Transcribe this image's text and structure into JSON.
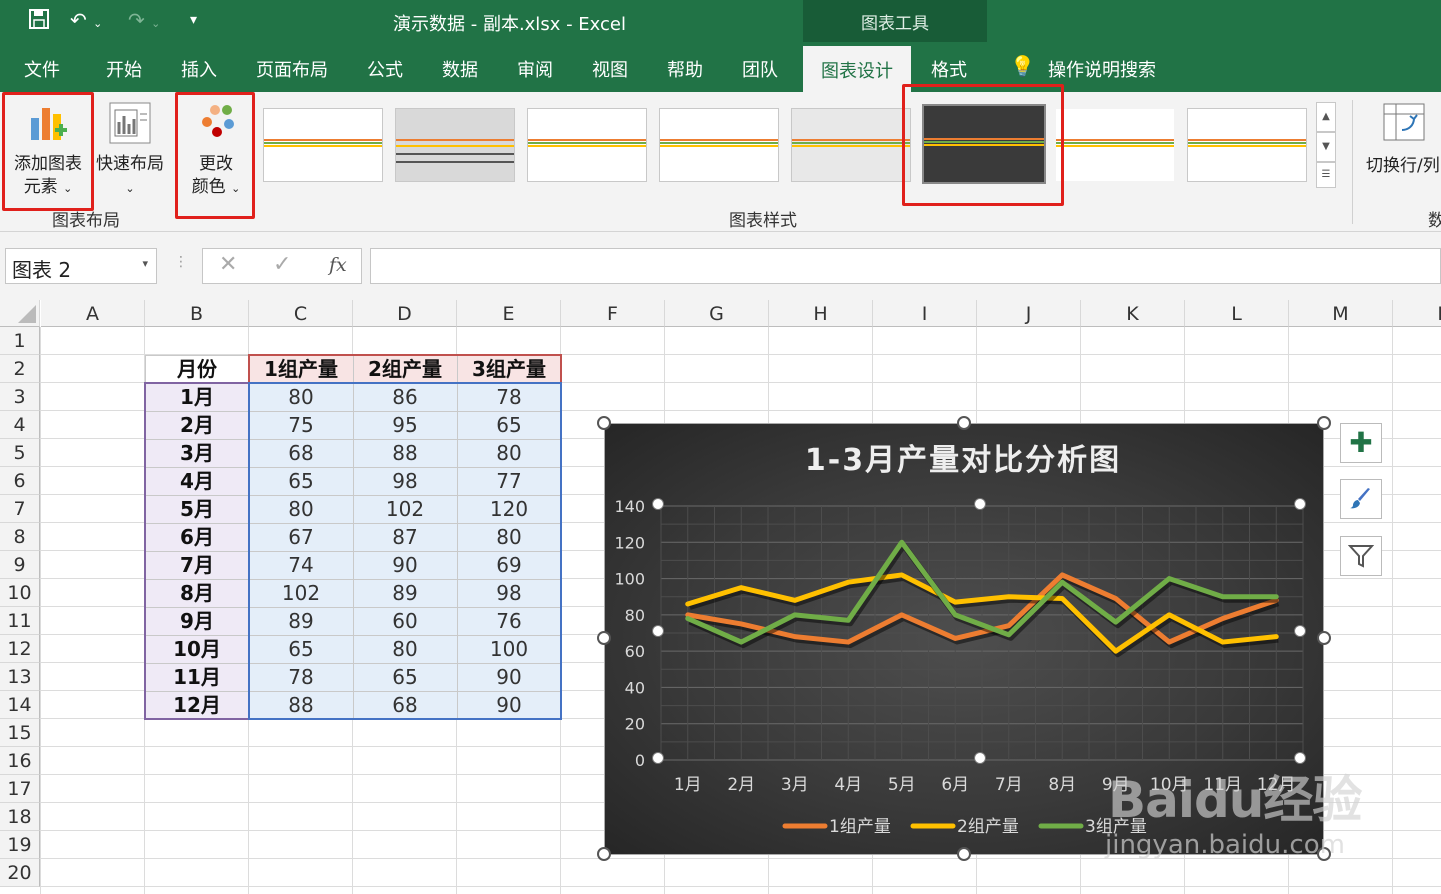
{
  "app": {
    "window_title": "演示数据 - 副本.xlsx  -  Excel",
    "tools_band": "图表工具"
  },
  "tabs": [
    "文件",
    "开始",
    "插入",
    "页面布局",
    "公式",
    "数据",
    "审阅",
    "视图",
    "帮助",
    "团队",
    "图表设计",
    "格式"
  ],
  "tell_me": "操作说明搜索",
  "ribbon": {
    "add_element": [
      "添加图表",
      "元素"
    ],
    "quick_layout": "快速布局",
    "change_colors": [
      "更改",
      "颜色"
    ],
    "group_layout": "图表布局",
    "group_styles": "图表样式",
    "switch_row_col": "切换行/列",
    "group_data": "数"
  },
  "formula_bar": {
    "name_box": "图表 2",
    "fx": "fx",
    "value": ""
  },
  "columns": [
    "A",
    "B",
    "C",
    "D",
    "E",
    "F",
    "G",
    "H",
    "I",
    "J",
    "K",
    "L",
    "M",
    "N"
  ],
  "rows": [
    "1",
    "2",
    "3",
    "4",
    "5",
    "6",
    "7",
    "8",
    "9",
    "10",
    "11",
    "12",
    "13",
    "14",
    "15",
    "16",
    "17",
    "18",
    "19",
    "20"
  ],
  "table": {
    "headers": [
      "月份",
      "1组产量",
      "2组产量",
      "3组产量"
    ],
    "rows": [
      [
        "1月",
        "80",
        "86",
        "78"
      ],
      [
        "2月",
        "75",
        "95",
        "65"
      ],
      [
        "3月",
        "68",
        "88",
        "80"
      ],
      [
        "4月",
        "65",
        "98",
        "77"
      ],
      [
        "5月",
        "80",
        "102",
        "120"
      ],
      [
        "6月",
        "67",
        "87",
        "80"
      ],
      [
        "7月",
        "74",
        "90",
        "69"
      ],
      [
        "8月",
        "102",
        "89",
        "98"
      ],
      [
        "9月",
        "89",
        "60",
        "76"
      ],
      [
        "10月",
        "65",
        "80",
        "100"
      ],
      [
        "11月",
        "78",
        "65",
        "90"
      ],
      [
        "12月",
        "88",
        "68",
        "90"
      ]
    ]
  },
  "chart_data": {
    "type": "line",
    "title": "1-3月产量对比分析图",
    "categories": [
      "1月",
      "2月",
      "3月",
      "4月",
      "5月",
      "6月",
      "7月",
      "8月",
      "9月",
      "10月",
      "11月",
      "12月"
    ],
    "series": [
      {
        "name": "1组产量",
        "color": "#ED7D31",
        "values": [
          80,
          75,
          68,
          65,
          80,
          67,
          74,
          102,
          89,
          65,
          78,
          88
        ]
      },
      {
        "name": "2组产量",
        "color": "#FFC000",
        "values": [
          86,
          95,
          88,
          98,
          102,
          87,
          90,
          89,
          60,
          80,
          65,
          68
        ]
      },
      {
        "name": "3组产量",
        "color": "#70AD47",
        "values": [
          78,
          65,
          80,
          77,
          120,
          80,
          69,
          98,
          76,
          100,
          90,
          90
        ]
      }
    ],
    "ylim": [
      0,
      140
    ],
    "yticks": [
      "0",
      "20",
      "40",
      "60",
      "80",
      "100",
      "120",
      "140"
    ],
    "grid": true,
    "legend": "bottom",
    "style": "dark"
  },
  "watermark": {
    "brand": "Baidu经验",
    "url": "jingyan.baidu.com"
  }
}
